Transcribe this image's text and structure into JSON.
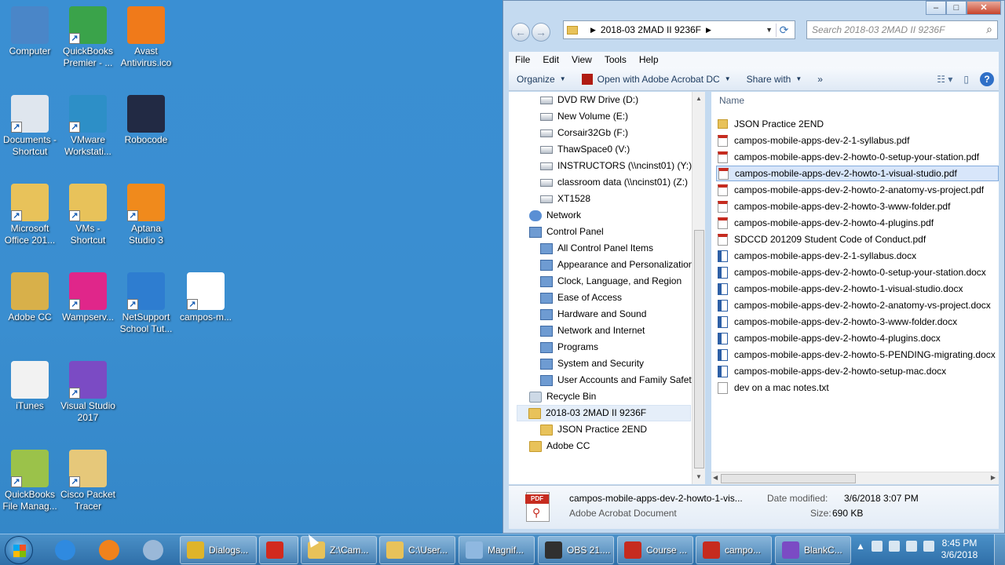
{
  "desktop": {
    "icons": [
      {
        "label": "Computer",
        "icon": "computer-icon",
        "color": "#4a86c8"
      },
      {
        "label": "QuickBooks\nPremier - ...",
        "icon": "quickbooks-icon",
        "color": "#3aa34a"
      },
      {
        "label": "Avast\nAntivirus.ico",
        "icon": "avast-icon",
        "color": "#f07a1a"
      },
      {
        "label": "Documents -\nShortcut",
        "icon": "documents-icon",
        "color": "#dfe6ee"
      },
      {
        "label": "VMware\nWorkstati...",
        "icon": "vmware-icon",
        "color": "#2d8fc7"
      },
      {
        "label": "Robocode",
        "icon": "robocode-icon",
        "color": "#222a44"
      },
      {
        "label": "Microsoft\nOffice 201...",
        "icon": "office-folder-icon",
        "color": "#e8c25a"
      },
      {
        "label": "VMs -\nShortcut",
        "icon": "folder-icon",
        "color": "#e8c25a"
      },
      {
        "label": "Aptana\nStudio 3",
        "icon": "aptana-icon",
        "color": "#f08a1c"
      },
      {
        "label": "Adobe CC",
        "icon": "adobe-folder-icon",
        "color": "#d8b04a"
      },
      {
        "label": "Wampserv...",
        "icon": "wampserver-icon",
        "color": "#e0268a"
      },
      {
        "label": "NetSupport\nSchool Tut...",
        "icon": "netsupport-icon",
        "color": "#2e7dd0"
      },
      {
        "label": "campos-m...",
        "icon": "pdf-icon",
        "color": "#ffffff"
      },
      {
        "label": "iTunes",
        "icon": "itunes-icon",
        "color": "#f2f2f2"
      },
      {
        "label": "Visual Studio\n2017",
        "icon": "visual-studio-icon",
        "color": "#7b4bc4"
      },
      {
        "label": "QuickBooks\nFile Manag...",
        "icon": "quickbooks-file-icon",
        "color": "#9bc24a"
      },
      {
        "label": "Cisco Packet\nTracer",
        "icon": "cisco-icon",
        "color": "#e6c87a"
      }
    ]
  },
  "explorer": {
    "address": {
      "crumb": "2018-03 2MAD II 9236F"
    },
    "search": {
      "placeholder": "Search 2018-03 2MAD II 9236F"
    },
    "menu": [
      "File",
      "Edit",
      "View",
      "Tools",
      "Help"
    ],
    "toolbar": {
      "organize": "Organize",
      "open_with": "Open with Adobe Acrobat DC",
      "share_with": "Share with",
      "more": "»"
    },
    "nav": [
      {
        "label": "DVD RW Drive (D:)",
        "type": "drive",
        "indent": 1
      },
      {
        "label": "New Volume (E:)",
        "type": "drive",
        "indent": 1
      },
      {
        "label": "Corsair32Gb (F:)",
        "type": "drive",
        "indent": 1
      },
      {
        "label": "ThawSpace0 (V:)",
        "type": "drive",
        "indent": 1
      },
      {
        "label": "INSTRUCTORS (\\\\ncinst01) (Y:)",
        "type": "drive",
        "indent": 1
      },
      {
        "label": "classroom data (\\\\ncinst01) (Z:)",
        "type": "drive",
        "indent": 1
      },
      {
        "label": "XT1528",
        "type": "drive",
        "indent": 1
      },
      {
        "label": "Network",
        "type": "net",
        "indent": 0
      },
      {
        "label": "Control Panel",
        "type": "cp",
        "indent": 0
      },
      {
        "label": "All Control Panel Items",
        "type": "cp",
        "indent": 1
      },
      {
        "label": "Appearance and Personalization",
        "type": "cp",
        "indent": 1
      },
      {
        "label": "Clock, Language, and Region",
        "type": "cp",
        "indent": 1
      },
      {
        "label": "Ease of Access",
        "type": "cp",
        "indent": 1
      },
      {
        "label": "Hardware and Sound",
        "type": "cp",
        "indent": 1
      },
      {
        "label": "Network and Internet",
        "type": "cp",
        "indent": 1
      },
      {
        "label": "Programs",
        "type": "cp",
        "indent": 1
      },
      {
        "label": "System and Security",
        "type": "cp",
        "indent": 1
      },
      {
        "label": "User Accounts and Family Safety",
        "type": "cp",
        "indent": 1
      },
      {
        "label": "Recycle Bin",
        "type": "bin",
        "indent": 0
      },
      {
        "label": "2018-03 2MAD II 9236F",
        "type": "folder",
        "indent": 0,
        "selected": true
      },
      {
        "label": "JSON Practice 2END",
        "type": "folder",
        "indent": 1
      },
      {
        "label": "Adobe CC",
        "type": "folder",
        "indent": 0
      }
    ],
    "columns": {
      "name": "Name"
    },
    "files": [
      {
        "name": "JSON Practice 2END",
        "type": "folder"
      },
      {
        "name": "campos-mobile-apps-dev-2-1-syllabus.pdf",
        "type": "pdf"
      },
      {
        "name": "campos-mobile-apps-dev-2-howto-0-setup-your-station.pdf",
        "type": "pdf"
      },
      {
        "name": "campos-mobile-apps-dev-2-howto-1-visual-studio.pdf",
        "type": "pdf",
        "selected": true
      },
      {
        "name": "campos-mobile-apps-dev-2-howto-2-anatomy-vs-project.pdf",
        "type": "pdf"
      },
      {
        "name": "campos-mobile-apps-dev-2-howto-3-www-folder.pdf",
        "type": "pdf"
      },
      {
        "name": "campos-mobile-apps-dev-2-howto-4-plugins.pdf",
        "type": "pdf"
      },
      {
        "name": "SDCCD 201209 Student Code of Conduct.pdf",
        "type": "pdf"
      },
      {
        "name": "campos-mobile-apps-dev-2-1-syllabus.docx",
        "type": "docx"
      },
      {
        "name": "campos-mobile-apps-dev-2-howto-0-setup-your-station.docx",
        "type": "docx"
      },
      {
        "name": "campos-mobile-apps-dev-2-howto-1-visual-studio.docx",
        "type": "docx"
      },
      {
        "name": "campos-mobile-apps-dev-2-howto-2-anatomy-vs-project.docx",
        "type": "docx"
      },
      {
        "name": "campos-mobile-apps-dev-2-howto-3-www-folder.docx",
        "type": "docx"
      },
      {
        "name": "campos-mobile-apps-dev-2-howto-4-plugins.docx",
        "type": "docx"
      },
      {
        "name": "campos-mobile-apps-dev-2-howto-5-PENDING-migrating.docx",
        "type": "docx"
      },
      {
        "name": "campos-mobile-apps-dev-2-howto-setup-mac.docx",
        "type": "docx"
      },
      {
        "name": "dev on a mac notes.txt",
        "type": "txt"
      }
    ],
    "details": {
      "pdf_tag": "PDF",
      "name": "campos-mobile-apps-dev-2-howto-1-vis...",
      "type": "Adobe Acrobat Document",
      "modified_label": "Date modified:",
      "modified_value": "3/6/2018 3:07 PM",
      "size_label": "Size:",
      "size_value": "690 KB"
    }
  },
  "taskbar": {
    "pinned": [
      {
        "icon": "internet-explorer-icon",
        "color": "#2f8ae0"
      },
      {
        "icon": "firefox-icon",
        "color": "#f0821c"
      },
      {
        "icon": "safari-icon",
        "color": "#9ab8d8"
      }
    ],
    "buttons": [
      {
        "label": "Dialogs...",
        "icon": "chrome-icon",
        "color": "#dfb42a"
      },
      {
        "label": "",
        "icon": "opera-icon",
        "color": "#d22a1e"
      },
      {
        "label": "Z:\\Cam...",
        "icon": "folder-icon",
        "color": "#e8c25a"
      },
      {
        "label": "C:\\User...",
        "icon": "folder-icon",
        "color": "#e8c25a"
      },
      {
        "label": "Magnif...",
        "icon": "magnifier-icon",
        "color": "#8fb8e0"
      },
      {
        "label": "OBS 21....",
        "icon": "obs-icon",
        "color": "#303030"
      },
      {
        "label": "Course ...",
        "icon": "pdf-icon",
        "color": "#c62b1f"
      },
      {
        "label": "campo...",
        "icon": "pdf-icon",
        "color": "#c62b1f"
      },
      {
        "label": "BlankC...",
        "icon": "visual-studio-icon",
        "color": "#7b4bc4"
      }
    ],
    "clock": {
      "time": "8:45 PM",
      "date": "3/6/2018"
    }
  }
}
